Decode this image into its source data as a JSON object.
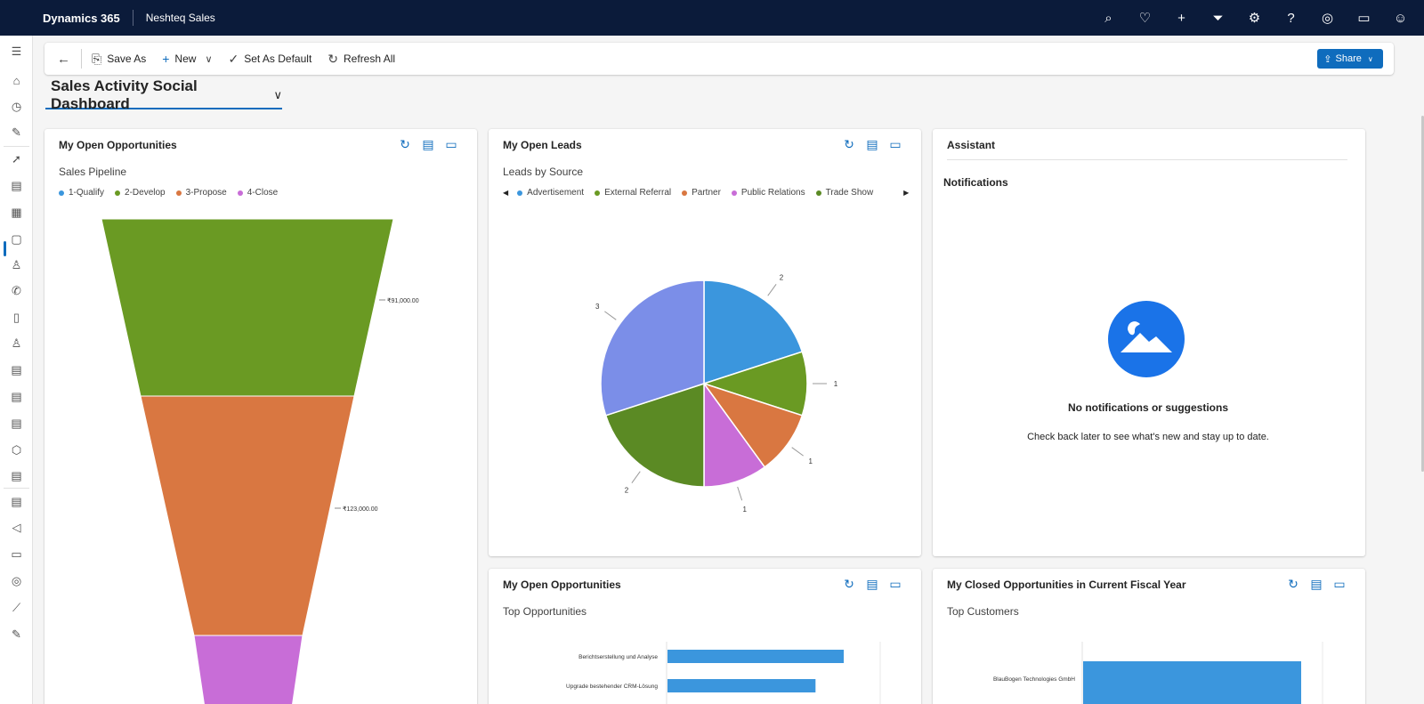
{
  "topbar": {
    "brand": "Dynamics 365",
    "app_name": "Neshteq Sales",
    "icons": [
      "search-icon",
      "lightbulb-icon",
      "plus-icon",
      "filter-icon",
      "settings-icon",
      "help-icon",
      "copilot-icon",
      "chat-icon",
      "person-feedback-icon"
    ]
  },
  "leftnav": {
    "icons": [
      "hamburger-icon",
      "home-icon",
      "recent-icon",
      "pinned-icon",
      "rocket-icon",
      "clipboard-icon",
      "dashboard-icon",
      "activities-icon",
      "contacts-icon",
      "phone-icon",
      "document-icon",
      "leads-icon",
      "opportunities-icon",
      "quotes-icon",
      "orders-icon",
      "products-icon",
      "invoices-icon",
      "competitors-icon",
      "marketing-icon",
      "catalog-icon",
      "goals-icon",
      "chart-icon",
      "tools-icon"
    ]
  },
  "commandbar": {
    "save_as": "Save As",
    "new": "New",
    "set_default": "Set As Default",
    "refresh_all": "Refresh All",
    "share": "Share"
  },
  "dashboard": {
    "title": "Sales Activity Social Dashboard"
  },
  "cards": {
    "opps": {
      "title": "My Open Opportunities",
      "subtitle": "Sales Pipeline"
    },
    "leads": {
      "title": "My Open Leads",
      "subtitle": "Leads by Source"
    },
    "assistant": {
      "title": "Assistant",
      "notifications": "Notifications",
      "empty_title": "No notifications or suggestions",
      "empty_text": "Check back later to see what's new and stay up to date."
    },
    "top_opps": {
      "title": "My Open Opportunities",
      "subtitle": "Top Opportunities"
    },
    "closed": {
      "title": "My Closed Opportunities in Current Fiscal Year",
      "subtitle": "Top Customers"
    }
  },
  "colors": {
    "qualify": "#3b96dd",
    "develop": "#6a9a23",
    "propose": "#d97741",
    "close": "#c86dd7",
    "public_relations": "#c86dd7",
    "trade_show": "#5b8a24",
    "slice_3": "#7b8ee8",
    "bar": "#3b96dd",
    "accent": "#0f6cbd",
    "header": "#0b1b3a"
  },
  "chart_data": [
    {
      "type": "funnel",
      "title": "Sales Pipeline",
      "categories": [
        "1-Qualify",
        "2-Develop",
        "3-Propose",
        "4-Close"
      ],
      "values": [
        null,
        91000,
        123000,
        null
      ],
      "value_labels": [
        "",
        "₹91,000.00",
        "₹123,000.00",
        ""
      ],
      "legend": "top-left"
    },
    {
      "type": "pie",
      "title": "Leads by Source",
      "legend_items": [
        "Advertisement",
        "External Referral",
        "Partner",
        "Public Relations",
        "Trade Show"
      ],
      "slices": [
        {
          "value": 2,
          "label": "2",
          "color_key": "qualify"
        },
        {
          "value": 1,
          "label": "1",
          "color_key": "develop"
        },
        {
          "value": 1,
          "label": "1",
          "color_key": "propose"
        },
        {
          "value": 1,
          "label": "1",
          "color_key": "public_relations"
        },
        {
          "value": 2,
          "label": "2",
          "color_key": "trade_show"
        },
        {
          "value": 3,
          "label": "3",
          "color_key": "slice_3"
        }
      ]
    },
    {
      "type": "bar",
      "orientation": "horizontal",
      "title": "Top Opportunities",
      "categories": [
        "Berichtserstellung und Analyse",
        "Upgrade bestehender CRM-Lösung"
      ],
      "values": [
        1.0,
        0.84
      ]
    },
    {
      "type": "bar",
      "orientation": "horizontal",
      "title": "Top Customers",
      "categories": [
        "BlauBogen Technologies GmbH"
      ],
      "values": [
        1.0
      ]
    }
  ]
}
